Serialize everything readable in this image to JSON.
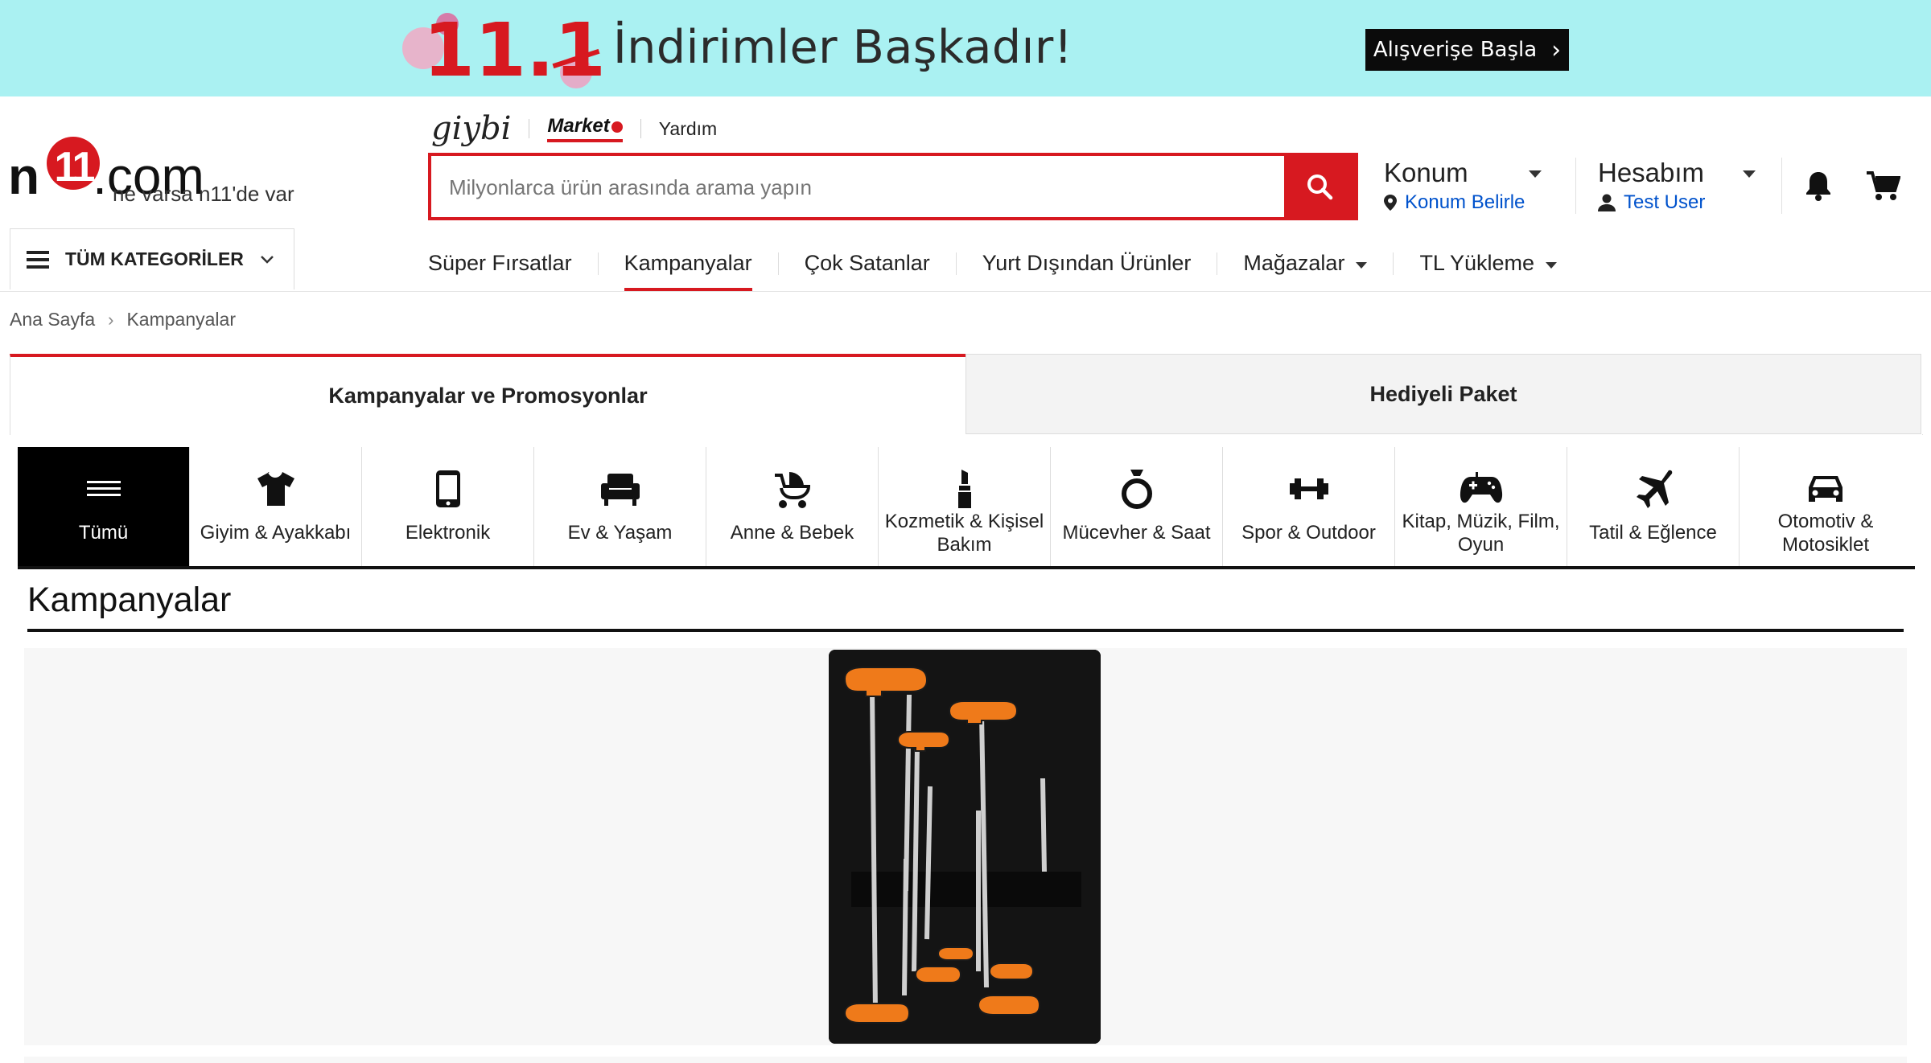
{
  "banner": {
    "badge": "11.11",
    "title": "İndirimler Başkadır!",
    "button_label": "Alışverişe Başla"
  },
  "header": {
    "logo_n": "n",
    "logo_11": "11",
    "logo_com": ".com",
    "slogan": "ne varsa n11'de var",
    "links": {
      "giybi": "giybi",
      "market": "Market",
      "help": "Yardım"
    },
    "search_placeholder": "Milyonlarca ürün arasında arama yapın",
    "location": {
      "title": "Konum",
      "action": "Konum Belirle"
    },
    "account": {
      "title": "Hesabım",
      "user": "Test User"
    }
  },
  "nav": {
    "all_categories": "TÜM KATEGORİLER",
    "items": [
      "Süper Fırsatlar",
      "Kampanyalar",
      "Çok Satanlar",
      "Yurt Dışından Ürünler",
      "Mağazalar",
      "TL Yükleme"
    ]
  },
  "breadcrumb": [
    "Ana Sayfa",
    "Kampanyalar"
  ],
  "tabs": [
    "Kampanyalar ve Promosyonlar",
    "Hediyeli Paket"
  ],
  "categories": [
    {
      "label": "Tümü",
      "icon": "menu-icon"
    },
    {
      "label": "Giyim & Ayakkabı",
      "icon": "tshirt-icon"
    },
    {
      "label": "Elektronik",
      "icon": "phone-icon"
    },
    {
      "label": "Ev & Yaşam",
      "icon": "armchair-icon"
    },
    {
      "label": "Anne & Bebek",
      "icon": "stroller-icon"
    },
    {
      "label": "Kozmetik & Kişisel Bakım",
      "icon": "lipstick-icon"
    },
    {
      "label": "Mücevher & Saat",
      "icon": "ring-icon"
    },
    {
      "label": "Spor & Outdoor",
      "icon": "dumbbell-icon"
    },
    {
      "label": "Kitap, Müzik, Film, Oyun",
      "icon": "gamepad-icon"
    },
    {
      "label": "Tatil & Eğlence",
      "icon": "airplane-icon"
    },
    {
      "label": "Otomotiv & Motosiklet",
      "icon": "car-icon"
    }
  ],
  "section_title": "Kampanyalar",
  "colors": {
    "brand_red": "#d71920",
    "banner_bg": "#aaf1f2",
    "link_blue": "#0052cc"
  }
}
